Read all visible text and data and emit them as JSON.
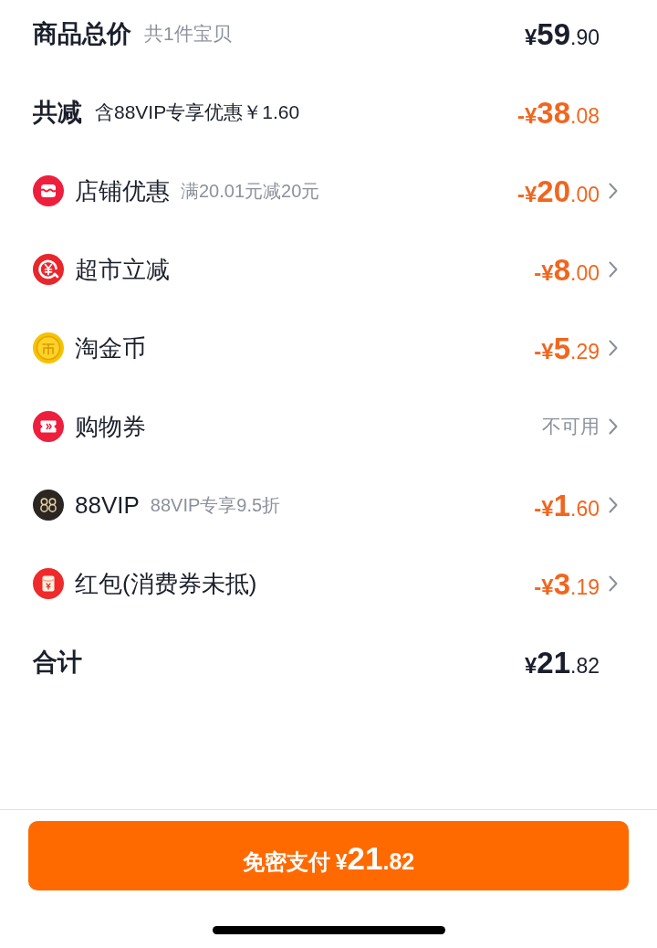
{
  "summary": [
    {
      "title": "商品总价",
      "subtitle": {
        "text": "共1件宝贝",
        "muted": true
      },
      "amount": {
        "color": "#1a1e2c",
        "currency": "¥",
        "integer": "59",
        "fraction": ".90"
      }
    },
    {
      "title": "共减",
      "subtitle": {
        "text": "含88VIP专享优惠￥1.60",
        "muted": false
      },
      "amount": {
        "color": "#f0661e",
        "currency": "-¥",
        "integer": "38",
        "fraction": ".08"
      }
    }
  ],
  "discounts": [
    {
      "kind": "store",
      "label": "店铺优惠",
      "note": "满20.01元减20元",
      "amount": {
        "color": "#f0661e",
        "currency": "-¥",
        "integer": "20",
        "fraction": ".00"
      }
    },
    {
      "kind": "market",
      "label": "超市立减",
      "amount": {
        "color": "#f0661e",
        "currency": "-¥",
        "integer": "8",
        "fraction": ".00"
      }
    },
    {
      "kind": "coin",
      "label": "淘金币",
      "amount": {
        "color": "#f0661e",
        "currency": "-¥",
        "integer": "5",
        "fraction": ".29"
      }
    },
    {
      "kind": "coupon",
      "label": "购物券",
      "status": "不可用"
    },
    {
      "kind": "vip",
      "label": "88VIP",
      "note": "88VIP专享9.5折",
      "amount": {
        "color": "#f0661e",
        "currency": "-¥",
        "integer": "1",
        "fraction": ".60"
      }
    },
    {
      "kind": "packet",
      "label": "红包(消费券未抵)",
      "amount": {
        "color": "#f0661e",
        "currency": "-¥",
        "integer": "3",
        "fraction": ".19"
      }
    }
  ],
  "total": {
    "title": "合计",
    "amount": {
      "color": "#1a1e2c",
      "currency": "¥",
      "integer": "21",
      "fraction": ".82"
    }
  },
  "pay_button": {
    "label": "免密支付",
    "amount": {
      "currency": "¥",
      "integer": "21",
      "fraction": ".82"
    }
  }
}
